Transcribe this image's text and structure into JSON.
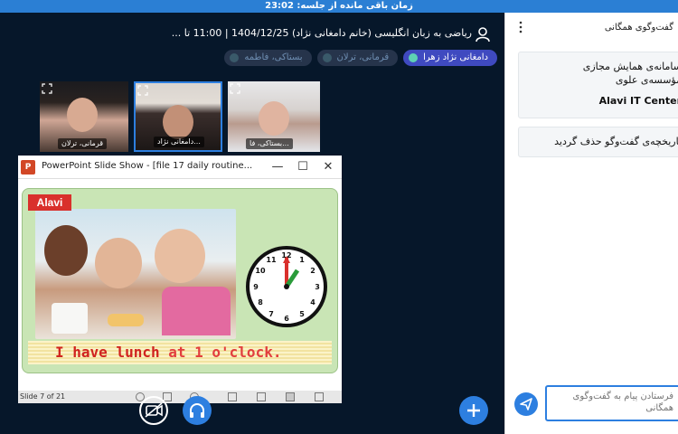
{
  "session": {
    "time_remaining_label": "زمان باقی مانده از جلسه: 23:02"
  },
  "meeting": {
    "title": "ریاضی به زبان انگلیسی (خانم دامغانی نژاد) 1404/12/25 | 11:00 تا ..."
  },
  "participants": {
    "chips": [
      {
        "label": "دامغانی نژاد زهرا",
        "active": true
      },
      {
        "label": "قرمانی، ترلان",
        "active": false
      },
      {
        "label": "بستاکی، فاطمه",
        "active": false
      }
    ]
  },
  "video_tiles": [
    {
      "name": "قرمانی، ترلان"
    },
    {
      "name": "دامغانی نژاد..."
    },
    {
      "name": "بستاکی، فا..."
    }
  ],
  "powerpoint": {
    "logo_letter": "P",
    "window_title": "PowerPoint Slide Show - [file 17 daily routine...",
    "minimize": "—",
    "maximize": "☐",
    "close": "✕",
    "slide_logo": "Alavi",
    "caption_main": "I have lunch ",
    "caption_accent": "at 1 o'clock.",
    "status": "Slide 7 of 21"
  },
  "chat": {
    "header": "گفت‌وگوی همگانی",
    "message1_line1": "سامانه‌ی همایش مجازی",
    "message1_line2": "مؤسسه‌ی علوی",
    "message1_org": "Alavi IT Center",
    "message2": "تاریخچه‌ی گفت‌وگو حذف گردید",
    "input_placeholder": "فرستادن پیام به گفت‌وگوی همگانی"
  },
  "colors": {
    "accent": "#2d7fe0",
    "topbar": "#2b7fd4",
    "main_bg": "#06172a",
    "active_chip": "#3f4ac0"
  },
  "icons": [
    "user-icon",
    "expand-icon",
    "mic-icon",
    "camera-off-icon",
    "headphones-icon",
    "plus-icon",
    "send-icon",
    "kebab-icon",
    "clock-icon"
  ]
}
